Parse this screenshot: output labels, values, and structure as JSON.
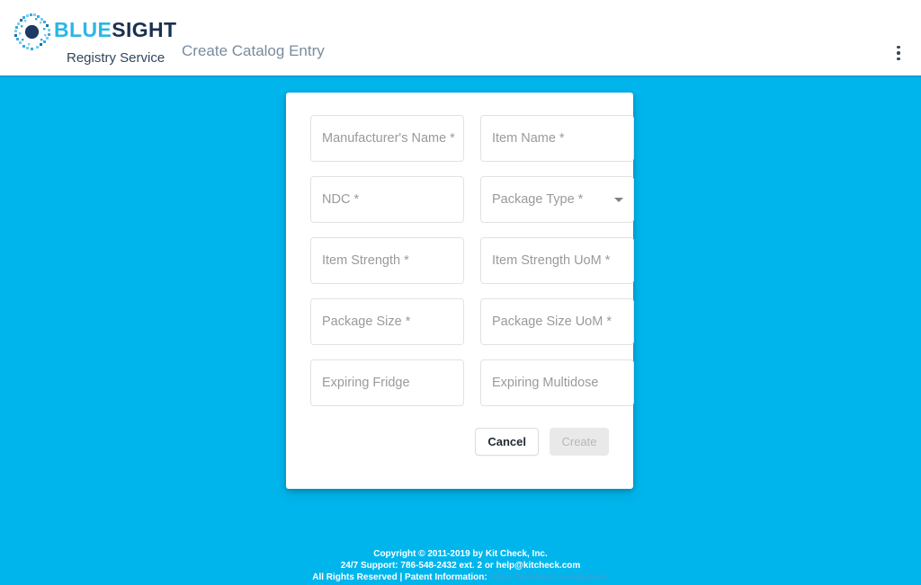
{
  "header": {
    "brand": {
      "logo_icon": "bluesight-pixel-ring-icon",
      "wordmark_part1": "BLUE",
      "wordmark_part2": "SIGHT",
      "subtitle": "Registry Service",
      "color_blue": "#2cb6e8",
      "color_sight": "#1b3050"
    },
    "page_title": "Create Catalog Entry",
    "overflow_menu": {
      "icon": "kebab-menu-icon",
      "label": "More options"
    },
    "background": "#ffffff",
    "border_color": "#0d9ed4"
  },
  "theme": {
    "page_background": "#00b5ec",
    "card_background": "#ffffff",
    "field_border": "#e2e2e2",
    "placeholder_color": "#9a9a9e"
  },
  "card": {
    "fields": [
      {
        "name": "manufacturers-name",
        "placeholder": "Manufacturer's Name *",
        "value": "",
        "type": "text"
      },
      {
        "name": "item-name",
        "placeholder": "Item Name *",
        "value": "",
        "type": "text"
      },
      {
        "name": "ndc",
        "placeholder": "NDC *",
        "value": "",
        "type": "text"
      },
      {
        "name": "package-type",
        "placeholder": "Package Type *",
        "value": "",
        "type": "select"
      },
      {
        "name": "item-strength",
        "placeholder": "Item Strength *",
        "value": "",
        "type": "text"
      },
      {
        "name": "item-strength-uom",
        "placeholder": "Item Strength UoM *",
        "value": "",
        "type": "text"
      },
      {
        "name": "package-size",
        "placeholder": "Package Size *",
        "value": "",
        "type": "text"
      },
      {
        "name": "package-size-uom",
        "placeholder": "Package Size UoM *",
        "value": "",
        "type": "text"
      },
      {
        "name": "expiring-fridge",
        "placeholder": "Expiring Fridge",
        "value": "",
        "type": "text"
      },
      {
        "name": "expiring-multidose",
        "placeholder": "Expiring Multidose",
        "value": "",
        "type": "text"
      }
    ],
    "actions": {
      "cancel_label": "Cancel",
      "create_label": "Create",
      "create_disabled": true
    }
  },
  "footer": {
    "line1": "Copyright © 2011-2019 by Kit Check, Inc.",
    "line2": "24/7 Support: 786-548-2432 ext. 2 or help@kitcheck.com",
    "line3_prefix": "All Rights Reserved | Patent Information:",
    "patent_link_text": "https://kitcheck.com/patent/",
    "link_color": "#2fa5d8"
  }
}
